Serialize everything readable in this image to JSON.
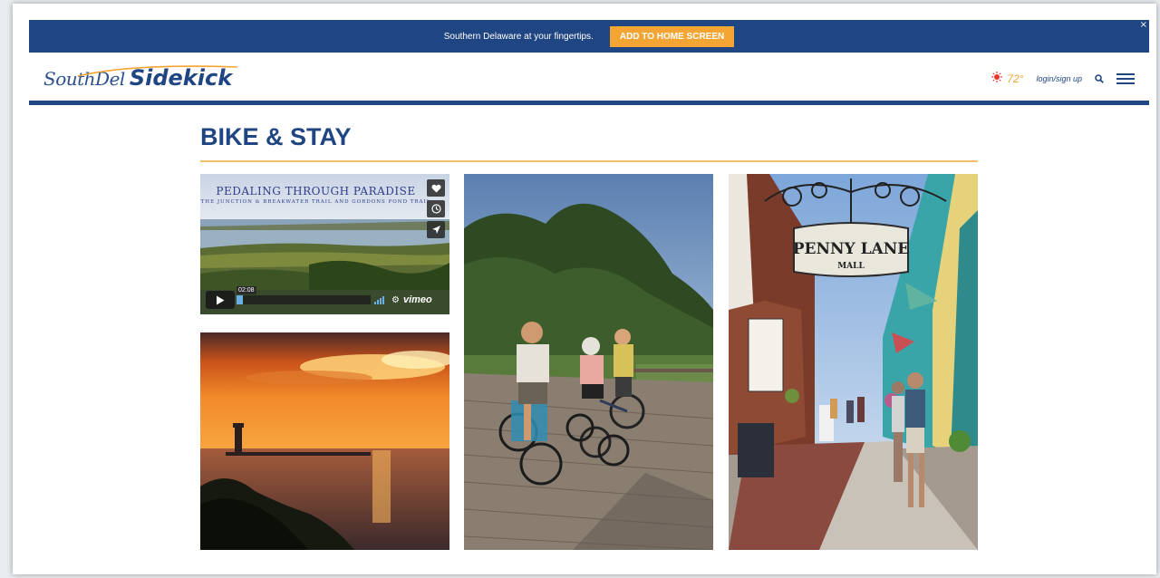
{
  "promo": {
    "text": "Southern Delaware at your fingertips.",
    "button_label": "ADD TO HOME SCREEN",
    "close_label": "×"
  },
  "header": {
    "logo_script": "SouthDel",
    "logo_bold": "Sidekick",
    "temperature": "72°",
    "login_label": "login/sign up"
  },
  "page": {
    "title": "BIKE & STAY"
  },
  "video": {
    "title": "PEDALING THROUGH PARADISE",
    "subtitle": "THE JUNCTION & BREAKWATER TRAIL AND GORDONS POND TRAIL",
    "timecode": "02:08",
    "brand": "vimeo",
    "progress_fraction": 0.05
  },
  "street_sign": {
    "name": "PENNY LANE",
    "sub": "MALL"
  },
  "colors": {
    "brand_blue": "#1f4583",
    "accent_orange": "#f3a534"
  },
  "icons": {
    "weather": "sun-icon",
    "search": "search-icon",
    "menu": "hamburger-menu-icon",
    "like": "heart-icon",
    "watch_later": "clock-icon",
    "share": "share-icon",
    "play": "play-icon",
    "settings": "gear-icon"
  }
}
